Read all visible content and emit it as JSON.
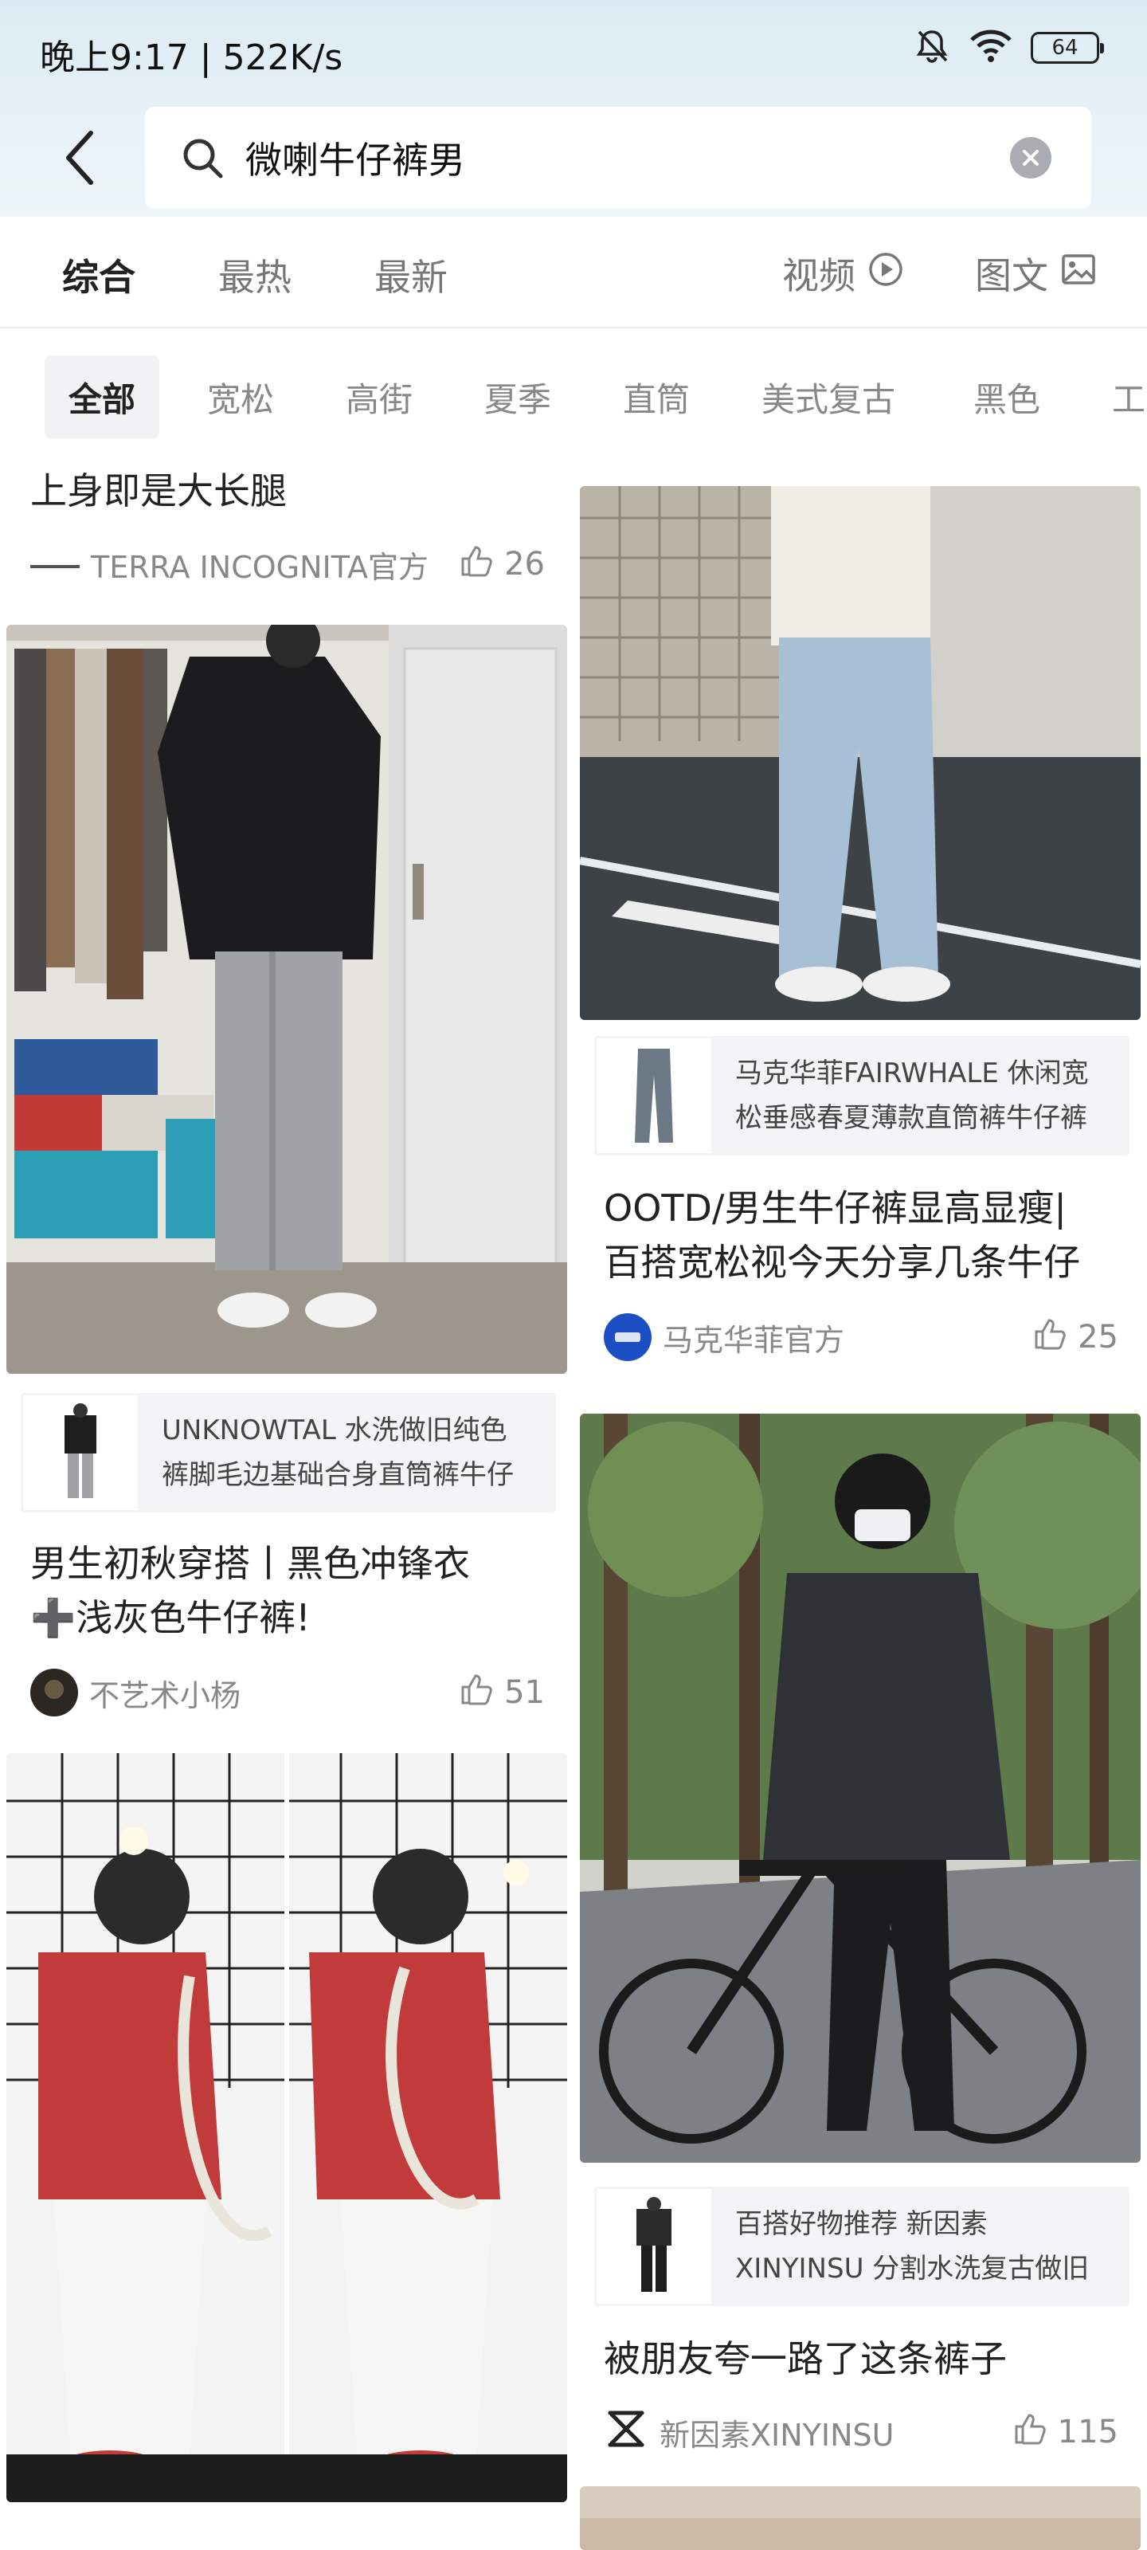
{
  "status_bar": {
    "time": "晚上9:17 | 522K/s",
    "battery": "64",
    "icons": [
      "mute-bell-icon",
      "wifi-icon",
      "battery-icon"
    ]
  },
  "search": {
    "query": "微喇牛仔裤男",
    "icons": [
      "back-arrow-icon",
      "search-icon",
      "clear-icon"
    ]
  },
  "tabs": [
    {
      "label": "综合",
      "active": true
    },
    {
      "label": "最热",
      "active": false
    },
    {
      "label": "最新",
      "active": false
    }
  ],
  "tab_right": [
    {
      "label": "视频",
      "icon": "play-circle-icon"
    },
    {
      "label": "图文",
      "icon": "image-icon"
    }
  ],
  "filters": [
    {
      "label": "全部",
      "active": true
    },
    {
      "label": "宽松"
    },
    {
      "label": "高街"
    },
    {
      "label": "夏季"
    },
    {
      "label": "直筒"
    },
    {
      "label": "美式复古"
    },
    {
      "label": "黑色"
    },
    {
      "label": "工"
    }
  ],
  "posts": {
    "left_top": {
      "title": "上身即是大长腿",
      "author": "TERRA INCOGNITA官方",
      "likes": "26"
    },
    "left_1": {
      "product": "UNKNOWTAL 水洗做旧纯色\n裤脚毛边基础合身直筒裤牛仔",
      "title_line1": "男生初秋穿搭丨黑色冲锋衣",
      "title_line2": "➕浅灰色牛仔裤!",
      "author": "不艺术小杨",
      "likes": "51"
    },
    "right_1": {
      "product": "马克华菲FAIRWHALE 休闲宽\n松垂感春夏薄款直筒裤牛仔裤",
      "title_line1": "OOTD/男生牛仔裤显高显瘦|",
      "title_line2": "百搭宽松视今天分享几条牛仔",
      "author": "马克华菲官方",
      "likes": "25"
    },
    "right_2": {
      "product": "百搭好物推荐 新因素\nXINYINSU 分割水洗复古做旧",
      "title": "被朋友夸一路了这条裤子",
      "author": "新因素XINYINSU",
      "likes": "115"
    }
  },
  "colors": {
    "accent_blue": "#1d4fc4",
    "text_primary": "#222222",
    "text_secondary": "#888888",
    "top_gradient": "#dcebf3"
  }
}
